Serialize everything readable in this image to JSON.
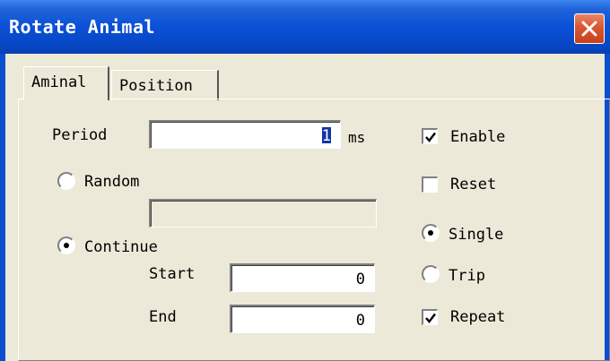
{
  "window": {
    "title": "Rotate Animal"
  },
  "tabs": [
    {
      "label": "Aminal",
      "active": true
    },
    {
      "label": "Position",
      "active": false
    }
  ],
  "period": {
    "label": "Period",
    "value": "1",
    "unit": "ms"
  },
  "random": {
    "label": "Random",
    "selected": false,
    "value": ""
  },
  "continue": {
    "label": "Continue",
    "selected": true,
    "start": {
      "label": "Start",
      "value": "0"
    },
    "end": {
      "label": "End",
      "value": "0"
    }
  },
  "enable": {
    "label": "Enable",
    "checked": true
  },
  "reset": {
    "label": "Reset",
    "checked": false
  },
  "single": {
    "label": "Single",
    "selected": true
  },
  "trip": {
    "label": "Trip",
    "selected": false
  },
  "repeat": {
    "label": "Repeat",
    "checked": true
  },
  "colors": {
    "titlebar": "#0a50d6",
    "close": "#d9562f",
    "face": "#ece9d8",
    "caret": "#1034a6"
  },
  "icons": {
    "close": "close-icon",
    "check": "check-icon",
    "radio_dot": "radio-dot-icon"
  }
}
